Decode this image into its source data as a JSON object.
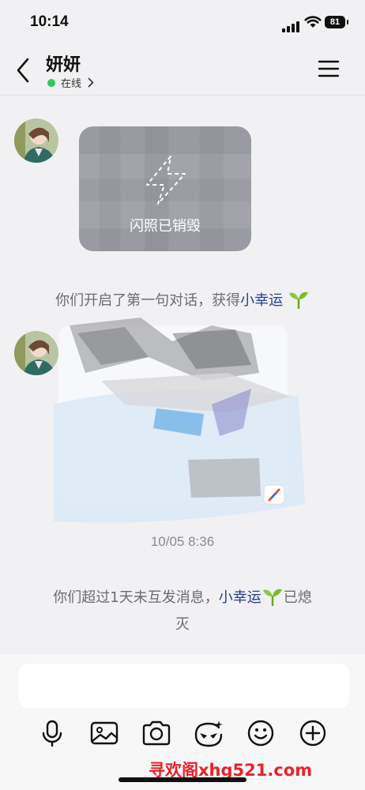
{
  "status": {
    "time": "10:14",
    "battery": "81"
  },
  "header": {
    "title": "妍妍",
    "presence": "在线"
  },
  "messages": {
    "flash_photo_label": "闪照已销毁",
    "system_msg_1": {
      "prefix": "你们开启了第一句对话，获得",
      "link": "小幸运"
    },
    "timestamp": "10/05 8:36",
    "system_msg_2": {
      "prefix": "你们超过1天未互发消息，",
      "link": "小幸运",
      "suffix": "已熄",
      "line2": "灭"
    }
  },
  "input": {
    "placeholder": ""
  },
  "toolbar": [
    "mic-icon",
    "image-icon",
    "camera-icon",
    "sticker-icon",
    "emoji-icon",
    "plus-icon"
  ],
  "watermark": "寻欢阁xhg521.com",
  "colors": {
    "accent_link": "#25408f",
    "online_dot": "#34c759",
    "watermark": "#e8222a"
  }
}
